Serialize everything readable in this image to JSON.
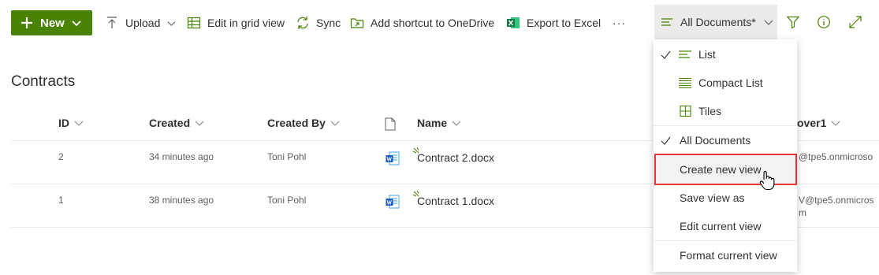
{
  "toolbar": {
    "new_label": "New",
    "upload_label": "Upload",
    "grid_label": "Edit in grid view",
    "sync_label": "Sync",
    "shortcut_label": "Add shortcut to OneDrive",
    "export_label": "Export to Excel",
    "more_label": "···",
    "view_label": "All Documents*",
    "accent_color": "#498205"
  },
  "page": {
    "title": "Contracts"
  },
  "table": {
    "headers": {
      "id": "ID",
      "created": "Created",
      "created_by": "Created By",
      "name": "Name",
      "approver": "over1"
    },
    "rows": [
      {
        "id": "2",
        "created": "34 minutes ago",
        "created_by": "Toni Pohl",
        "name": "Contract 2.docx",
        "approver": "@tpe5.onmicroso",
        "approver2": ""
      },
      {
        "id": "1",
        "created": "38 minutes ago",
        "created_by": "Toni Pohl",
        "name": "Contract 1.docx",
        "approver": "V@tpe5.onmicros",
        "approver2": "m"
      }
    ]
  },
  "menu": {
    "items": [
      {
        "label": "List",
        "checked": true,
        "icon": "list-icon"
      },
      {
        "label": "Compact List",
        "checked": false,
        "icon": "compact-list-icon"
      },
      {
        "label": "Tiles",
        "checked": false,
        "icon": "tiles-icon"
      },
      {
        "label": "All Documents",
        "checked": true
      },
      {
        "label": "Create new view",
        "highlighted": true
      },
      {
        "label": "Save view as"
      },
      {
        "label": "Edit current view"
      },
      {
        "label": "Format current view"
      }
    ],
    "highlight_color": "#e8343b"
  }
}
